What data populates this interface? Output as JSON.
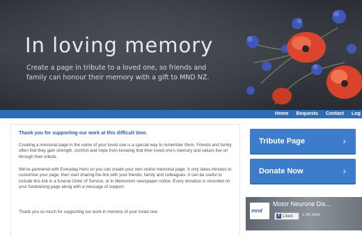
{
  "hero": {
    "title": "In loving memory",
    "subtitle": "Create a page in tribute to a loved one, so friends and family can honour their memory with a gift to MND NZ."
  },
  "nav": {
    "items": [
      "Home",
      "Bequests",
      "Contact",
      "Log in"
    ]
  },
  "content": {
    "heading": "Thank you for supporting our work at this difficult time.",
    "paragraphs": [
      "Creating a memorial page in the name of your loved one is a special way to remember them. Friends and family often find they gain strength, comfort and hope from knowing that their loved one's memory and values live on through their tribute.",
      "We've partnered with Everyday Hero so you can create your own online memorial page. It only takes minutes to customise your page, then start sharing the link with your friends, family and colleagues. It can be useful to include this link in a funeral Order of Service, or in Memorium newspaper notice. Every donation is recorded on your fundraising page along with a message of support.",
      "Thank you so much for supporting our work in memory of your loved one."
    ]
  },
  "sidebar": {
    "tribute_label": "Tribute Page",
    "donate_label": "Donate Now",
    "chevron": "›"
  },
  "facebook": {
    "logo_text": "mnd",
    "page_name": "Motor Neurone Dis...",
    "like_label": "Liked",
    "likes": "2,3K likes"
  },
  "colors": {
    "nav_bar": "#2f6dbb",
    "button": "#3d7ccb",
    "heading": "#2f5fa7"
  }
}
